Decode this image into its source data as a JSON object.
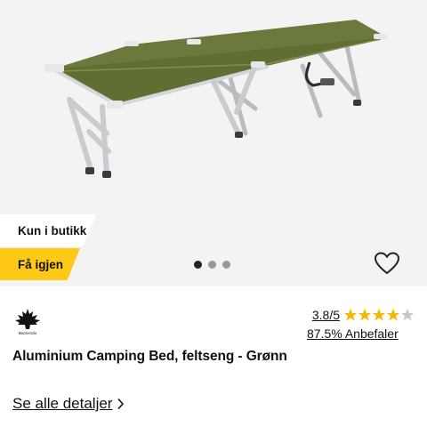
{
  "badges": {
    "store": "Kun i butikk",
    "restock": "Få igjen"
  },
  "carousel": {
    "total": 3,
    "active_index": 0
  },
  "brand": {
    "logo_text": "MacKenzie"
  },
  "rating": {
    "score_text": "3.8/5",
    "score": 3.8,
    "max": 5,
    "recommend_text": "87.5% Anbefaler"
  },
  "product": {
    "title": "Aluminium Camping Bed, feltseng - Grønn"
  },
  "details": {
    "label": "Se alle detaljer"
  },
  "colors": {
    "badge_yellow": "#ffc915",
    "star_gold": "#f5b800",
    "star_empty": "#c8c8c8",
    "fabric_green": "#6b7a3c",
    "frame_silver": "#c9cccf"
  },
  "icons": {
    "favorite": "heart-outline-icon",
    "more": "chevron-right-icon"
  }
}
